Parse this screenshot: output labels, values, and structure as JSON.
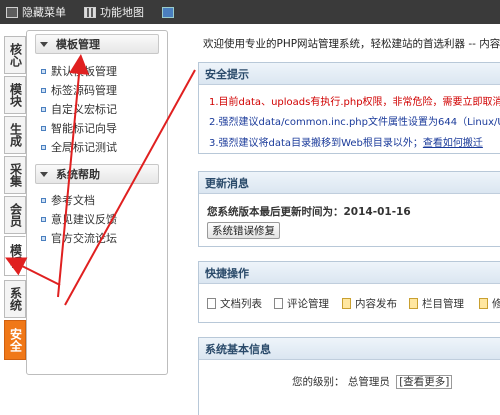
{
  "topbar": {
    "hide_menu": "隐藏菜单",
    "feature_map": "功能地图"
  },
  "left_tabs": [
    "核心",
    "模块",
    "生成",
    "采集",
    "会员",
    "模板",
    "系统",
    "安全"
  ],
  "sidebar": {
    "section1_title": "模板管理",
    "section1_items": [
      "默认模板管理",
      "标签源码管理",
      "自定义宏标记",
      "智能标记向导",
      "全局标记测试"
    ],
    "section2_title": "系统帮助",
    "section2_items": [
      "参考文档",
      "意见建议反馈",
      "官方交流论坛"
    ]
  },
  "main": {
    "welcome": "欢迎使用专业的PHP网站管理系统，轻松建站的首选利器 -- 内容",
    "security": {
      "title": "安全提示",
      "tip1": "1.目前data、uploads有执行.php权限，非常危险，需要立即取消",
      "tip2": "2.强烈建议data/common.inc.php文件属性设置为644（Linux/Unix",
      "tip3_prefix": "3.强烈建议将data目录搬移到Web根目录以外；",
      "tip3_link": "查看如何搬迁"
    },
    "updates": {
      "title": "更新消息",
      "text": "您系统版本最后更新时间为：2014-01-16",
      "button": "系统错误修复"
    },
    "quick": {
      "title": "快捷操作",
      "items": [
        "文档列表",
        "评论管理",
        "内容发布",
        "栏目管理",
        "修"
      ]
    },
    "sysinfo": {
      "title": "系统基本信息",
      "level_label": "您的级别：",
      "level_value": "总管理员",
      "view_link": "[查看更多]"
    }
  },
  "colors": {
    "topbar": "#3a3a3a",
    "panel_header": "#dbe6f1",
    "warning_red": "#d00000",
    "link_blue": "#1a3a9a",
    "annotation_red": "#e02020",
    "safety_tab": "#f07818"
  }
}
